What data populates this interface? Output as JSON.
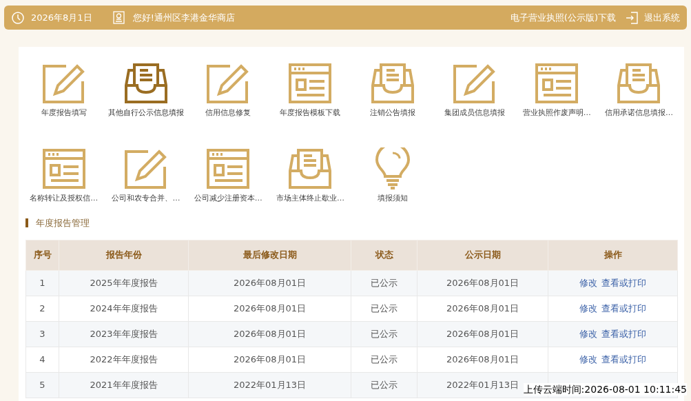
{
  "top_bar": {
    "date": "2026年8月1日",
    "greeting": "您好!通州区李港金华商店",
    "license_download": "电子营业执照(公示版)下载",
    "logout": "退出系统"
  },
  "shortcuts": [
    {
      "label": "年度报告填写",
      "kind": "edit",
      "selected": false
    },
    {
      "label": "其他自行公示信息填报",
      "kind": "inbox",
      "selected": true
    },
    {
      "label": "信用信息修复",
      "kind": "edit",
      "selected": false
    },
    {
      "label": "年度报告模板下载",
      "kind": "window",
      "selected": false
    },
    {
      "label": "注销公告填报",
      "kind": "inbox",
      "selected": false
    },
    {
      "label": "集团成员信息填报",
      "kind": "edit",
      "selected": false
    },
    {
      "label": "营业执照作废声明…",
      "kind": "window",
      "selected": false
    },
    {
      "label": "信用承诺信息填报…",
      "kind": "inbox",
      "selected": false
    },
    {
      "label": "名称转让及授权信…",
      "kind": "window",
      "selected": false
    },
    {
      "label": "公司和农专合并、…",
      "kind": "edit",
      "selected": false
    },
    {
      "label": "公司减少注册资本…",
      "kind": "window",
      "selected": false
    },
    {
      "label": "市场主体终止歇业…",
      "kind": "inbox",
      "selected": false
    },
    {
      "label": "填报须知",
      "kind": "bulb",
      "selected": false
    }
  ],
  "section_title": "年度报告管理",
  "table": {
    "columns": [
      "序号",
      "报告年份",
      "最后修改日期",
      "状态",
      "公示日期",
      "操作"
    ],
    "rows": [
      {
        "no": "1",
        "year": "2025年年度报告",
        "modified": "2026年08月01日",
        "status": "已公示",
        "published": "2026年08月01日",
        "actions": [
          "修改",
          "查看或打印"
        ]
      },
      {
        "no": "2",
        "year": "2024年年度报告",
        "modified": "2026年08月01日",
        "status": "已公示",
        "published": "2026年08月01日",
        "actions": [
          "修改",
          "查看或打印"
        ]
      },
      {
        "no": "3",
        "year": "2023年年度报告",
        "modified": "2026年08月01日",
        "status": "已公示",
        "published": "2026年08月01日",
        "actions": [
          "修改",
          "查看或打印"
        ]
      },
      {
        "no": "4",
        "year": "2022年年度报告",
        "modified": "2026年08月01日",
        "status": "已公示",
        "published": "2026年08月01日",
        "actions": [
          "修改",
          "查看或打印"
        ]
      },
      {
        "no": "5",
        "year": "2021年年度报告",
        "modified": "2022年01月13日",
        "status": "已公示",
        "published": "2022年01月13日",
        "actions": []
      }
    ]
  },
  "upload_time": "上传云端时间:2026-08-01 10:11:45"
}
